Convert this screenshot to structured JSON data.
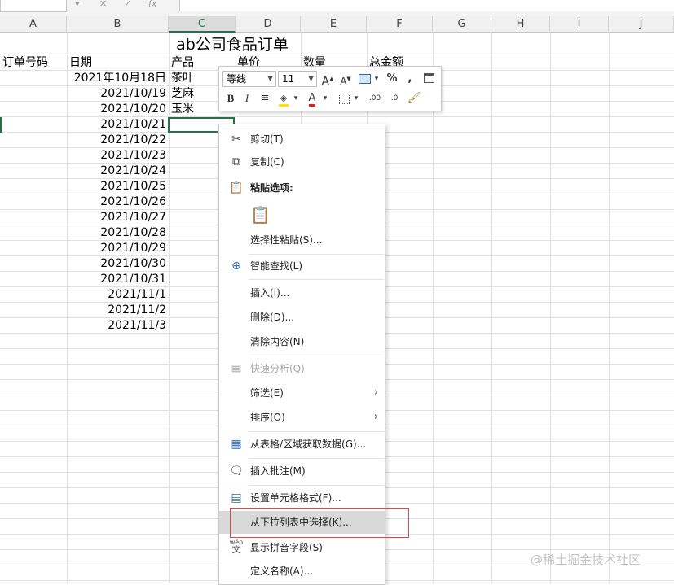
{
  "columns": [
    "A",
    "B",
    "C",
    "D",
    "E",
    "F",
    "G",
    "H",
    "I",
    "J"
  ],
  "sheet": {
    "title": "ab公司食品订单",
    "headers": [
      "订单号码",
      "日期",
      "产品",
      "单价",
      "数量",
      "总金额"
    ],
    "dates": [
      "2021年10月18日",
      "2021/10/19",
      "2021/10/20",
      "2021/10/21",
      "2021/10/22",
      "2021/10/23",
      "2021/10/24",
      "2021/10/25",
      "2021/10/26",
      "2021/10/27",
      "2021/10/28",
      "2021/10/29",
      "2021/10/30",
      "2021/10/31",
      "2021/11/1",
      "2021/11/2",
      "2021/11/3"
    ],
    "products": [
      "茶叶",
      "芝麻",
      "玉米"
    ]
  },
  "mini_toolbar": {
    "font_name": "等线",
    "font_size": "11",
    "grow_font": "A",
    "shrink_font": "A",
    "percent": "%",
    "comma": ",",
    "bold": "B",
    "italic": "I",
    "font_color": "A",
    "inc_decimal": ".00",
    "dec_decimal": ".0"
  },
  "context_menu": {
    "cut": "剪切(T)",
    "copy": "复制(C)",
    "paste_options": "粘贴选项:",
    "paste_special": "选择性粘贴(S)...",
    "smart_lookup": "智能查找(L)",
    "insert": "插入(I)...",
    "delete": "删除(D)...",
    "clear": "清除内容(N)",
    "quick_analysis": "快速分析(Q)",
    "filter": "筛选(E)",
    "sort": "排序(O)",
    "from_table": "从表格/区域获取数据(G)...",
    "insert_comment": "插入批注(M)",
    "format_cells": "设置单元格格式(F)...",
    "pick_from_list": "从下拉列表中选择(K)...",
    "phonetic": "显示拼音字段(S)",
    "define_name": "定义名称(A)...",
    "phonetic_icon_text": "wén"
  },
  "watermark": "@稀土掘金技术社区",
  "colors": {
    "accent": "#217346",
    "highlight": "#d9d9d9",
    "annotation": "#e0474c"
  }
}
